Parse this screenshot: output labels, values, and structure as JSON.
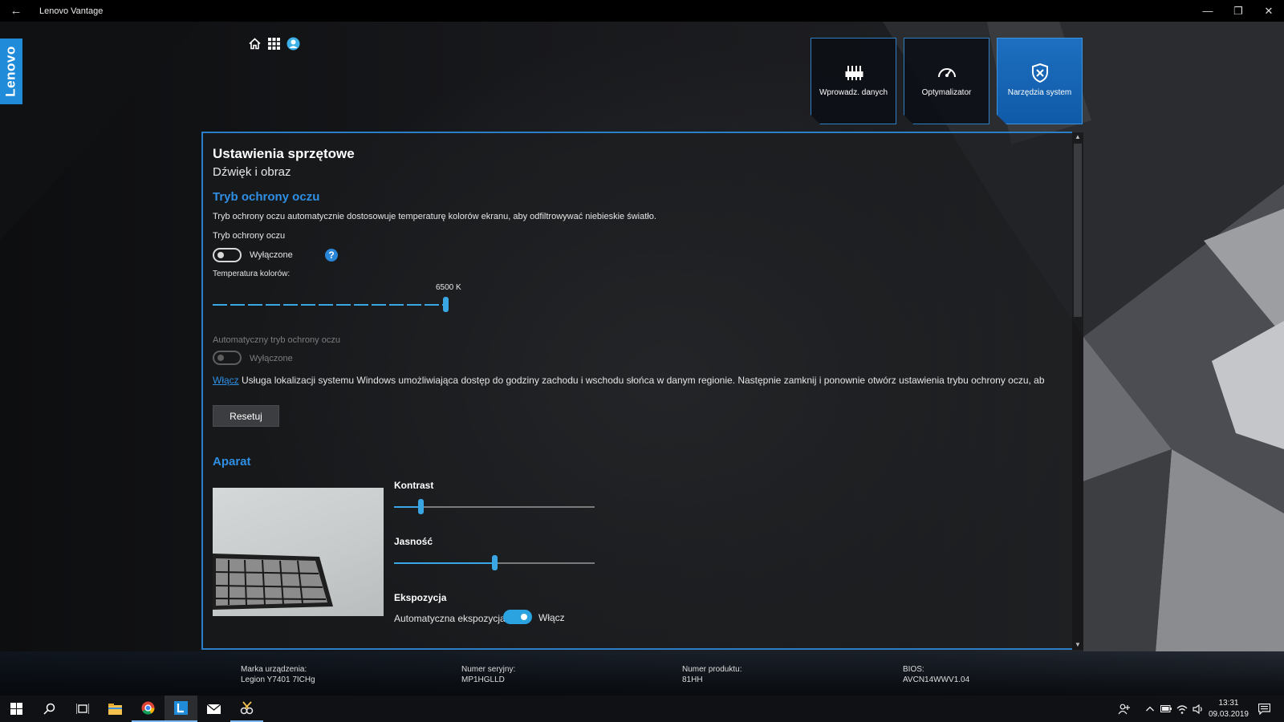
{
  "window": {
    "title": "Lenovo Vantage"
  },
  "logo": {
    "text": "Lenovo"
  },
  "nav": {
    "tiles": [
      {
        "label": "Wprowadz. danych",
        "icon": "equalizer-icon"
      },
      {
        "label": "Optymalizator",
        "icon": "speedometer-icon"
      },
      {
        "label": "Narzędzia system",
        "icon": "shield-tools-icon",
        "active": true
      }
    ]
  },
  "page": {
    "title": "Ustawienia sprzętowe",
    "subtitle": "Dźwięk i obraz"
  },
  "eye_care": {
    "heading": "Tryb ochrony oczu",
    "description": "Tryb ochrony oczu automatycznie dostosowuje temperaturę kolorów ekranu, aby odfiltrowywać niebieskie światło.",
    "toggle_label": "Tryb ochrony oczu",
    "toggle_state": "Wyłączone",
    "help": "?",
    "temp_label": "Temperatura kolorów:",
    "temp_value": "6500 K",
    "temp_level": 1.0,
    "auto_label": "Automatyczny tryb ochrony oczu",
    "auto_state": "Wyłączone",
    "enable_link": "Włącz",
    "location_text": "Usługa lokalizacji systemu Windows umożliwiająca dostęp do godziny zachodu i wschodu słońca w danym regionie. Następnie zamknij i ponownie otwórz ustawienia trybu ochrony oczu, ab",
    "reset_button": "Resetuj"
  },
  "camera": {
    "heading": "Aparat",
    "contrast_label": "Kontrast",
    "contrast_level": 0.13,
    "brightness_label": "Jasność",
    "brightness_level": 0.5,
    "exposure_label": "Ekspozycja",
    "auto_exposure_label": "Automatyczna ekspozycja",
    "auto_exposure_state": "Włącz"
  },
  "footer": {
    "brand_label": "Marka urządzenia:",
    "brand_value": "Legion Y7401 7ICHg",
    "serial_label": "Numer seryjny:",
    "serial_value": "MP1HGLLD",
    "product_label": "Numer produktu:",
    "product_value": "81HH",
    "bios_label": "BIOS:",
    "bios_value": "AVCN14WWV1.04"
  },
  "taskbar": {
    "time": "13:31",
    "date": "09.03.2019"
  },
  "colors": {
    "accent": "#2f8fe4",
    "active_tile": "#1e6fc0",
    "slider": "#3aa7e4"
  }
}
